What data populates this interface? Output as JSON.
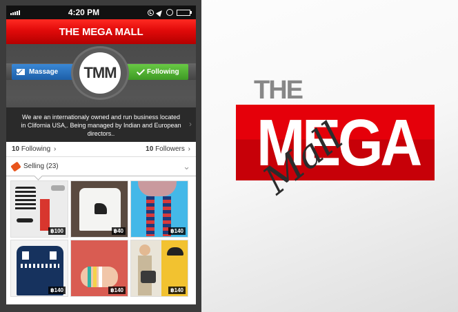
{
  "status_bar": {
    "time": "4:20 PM"
  },
  "app": {
    "title": "THE MEGA MALL"
  },
  "profile": {
    "avatar_text": "TMM",
    "message_label": "Massage",
    "follow_label": "Following",
    "bio": "We are an internationaly owned and run business located in Clifornia USA,. Being managed by Indian and European directors.."
  },
  "stats": {
    "following_count": "10",
    "following_label": "Following",
    "followers_count": "10",
    "followers_label": "Followers"
  },
  "selling": {
    "label": "Selling",
    "count": "(23)"
  },
  "products": [
    {
      "price": "฿100",
      "icon": "outfit-flatlay"
    },
    {
      "price": "฿40",
      "icon": "dog-sweater"
    },
    {
      "price": "฿140",
      "icon": "striped-socks"
    },
    {
      "price": "฿140",
      "icon": "reindeer-sweater"
    },
    {
      "price": "฿140",
      "icon": "bracelets"
    },
    {
      "price": "฿140",
      "icon": "model-with-bag"
    }
  ],
  "logo": {
    "the": "THE",
    "mega": "MEGA",
    "mall": "Mall"
  },
  "colors": {
    "brand_red": "#e5000a",
    "message_blue": "#1d5fa8",
    "follow_green": "#3d9a24"
  }
}
